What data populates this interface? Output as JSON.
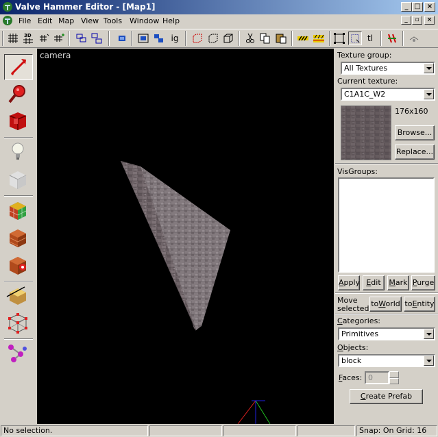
{
  "window": {
    "title": "Valve Hammer Editor - [Map1]"
  },
  "menu": {
    "items": [
      "File",
      "Edit",
      "Map",
      "View",
      "Tools",
      "Window",
      "Help"
    ]
  },
  "toolbar": {
    "buttons": [
      "grid-icon",
      "3d-grid-icon",
      "small-grid-icon",
      "larger-grid-icon",
      "group-icon",
      "ungroup-icon",
      "hide-icon",
      "vis-icon",
      "unhide-icon",
      "ignore-group-icon",
      "carve-icon",
      "hollow-icon",
      "make-solid-icon",
      "cut-icon",
      "copy-icon",
      "paste-icon",
      "texture-lock-icon",
      "stripe-icon",
      "selection-box-icon",
      "toggle-select-icon",
      "tl-icon",
      "entity-report-icon",
      "run-map-icon"
    ],
    "labels": {
      "ig": "ig",
      "tl": "tl",
      "3d": "3D"
    }
  },
  "left_tools": [
    "selection-tool-icon",
    "magnify-tool-icon",
    "camera-tool-icon",
    "entity-tool-icon",
    "block-tool-icon",
    "texture-application-icon",
    "apply-texture-icon",
    "decal-tool-icon",
    "clip-tool-icon",
    "vertex-tool-icon",
    "path-tool-icon"
  ],
  "viewport": {
    "label": "camera"
  },
  "texture_panel": {
    "group_label": "Texture group:",
    "group_value": "All Textures",
    "current_label": "Current texture:",
    "current_value": "C1A1C_W2",
    "size": "176x160",
    "browse": "Browse...",
    "replace": "Replace..."
  },
  "visgroups": {
    "label": "VisGroups:",
    "apply": "Apply",
    "edit": "Edit",
    "mark": "Mark",
    "purge": "Purge"
  },
  "move_selected": {
    "label_line1": "Move",
    "label_line2": "selected:",
    "to_world": "toWorld",
    "to_entity": "toEntity"
  },
  "objects_panel": {
    "categories_label": "Categories:",
    "categories_value": "Primitives",
    "objects_label": "Objects:",
    "objects_value": "block",
    "faces_label": "Faces:",
    "faces_value": "0",
    "create_prefab": "Create Prefab"
  },
  "status": {
    "text": "No selection.",
    "snap": "Snap: On Grid: 16"
  },
  "colors": {
    "title_start": "#0a246a",
    "title_end": "#a6caf0",
    "chrome": "#d4d0c8",
    "viewport": "#000000"
  }
}
